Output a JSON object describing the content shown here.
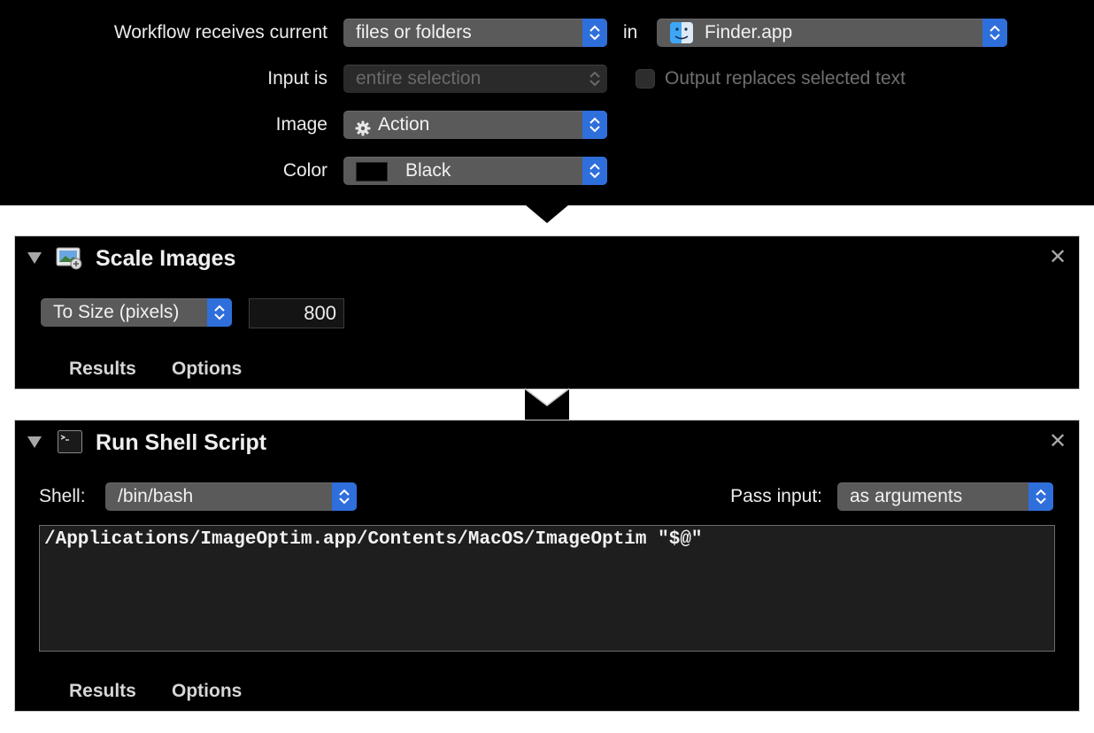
{
  "workflow": {
    "receives_label": "Workflow receives current",
    "receives_value": "files or folders",
    "in_label": "in",
    "app_value": "Finder.app",
    "input_label": "Input is",
    "input_value": "entire selection",
    "output_replaces_label": "Output replaces selected text",
    "output_replaces_checked": false,
    "image_label": "Image",
    "image_value": "Action",
    "color_label": "Color",
    "color_value": "Black",
    "color_swatch": "#000000"
  },
  "actions": [
    {
      "title": "Scale Images",
      "icon": "scale-images-icon",
      "mode_value": "To Size (pixels)",
      "size_value": "800",
      "tabs": [
        "Results",
        "Options"
      ]
    },
    {
      "title": "Run Shell Script",
      "icon": "terminal-icon",
      "shell_label": "Shell:",
      "shell_value": "/bin/bash",
      "pass_input_label": "Pass input:",
      "pass_input_value": "as arguments",
      "script": "/Applications/ImageOptim.app/Contents/MacOS/ImageOptim \"$@\"",
      "tabs": [
        "Results",
        "Options"
      ]
    }
  ],
  "colors": {
    "accent_blue": "#2f6fdc",
    "panel_bg": "#000000",
    "popup_bg": "#5a5a5a"
  }
}
